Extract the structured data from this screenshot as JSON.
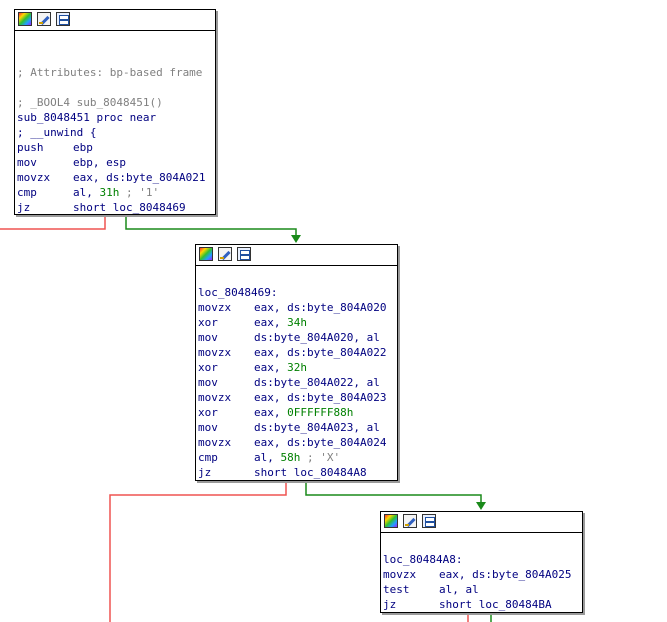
{
  "colors": {
    "edge_false": "#ef5350",
    "edge_true": "#1a8a1a",
    "text": "#000080",
    "comment": "#808080",
    "number": "#008000"
  },
  "header_icons": [
    "color-palette-icon",
    "edit-node-icon",
    "graph-overview-icon"
  ],
  "nodes": [
    {
      "lines": [
        {
          "kind": "blank"
        },
        {
          "kind": "blank"
        },
        {
          "kind": "comment",
          "text": "; Attributes: bp-based frame"
        },
        {
          "kind": "blank"
        },
        {
          "kind": "comment",
          "text": "; _BOOL4 sub_8048451()"
        },
        {
          "kind": "label",
          "text": "sub_8048451 proc near"
        },
        {
          "kind": "label",
          "text": "; __unwind {"
        },
        {
          "kind": "ins",
          "mnem": "push",
          "ops": "ebp"
        },
        {
          "kind": "ins",
          "mnem": "mov",
          "ops": "ebp, esp"
        },
        {
          "kind": "ins",
          "mnem": "movzx",
          "ops": "eax, ds:byte_804A021"
        },
        {
          "kind": "ins",
          "mnem": "cmp",
          "ops": "al, ",
          "num": "31h",
          "tail": " ; '1'"
        },
        {
          "kind": "ins",
          "mnem": "jz",
          "ops": "short loc_8048469"
        }
      ]
    },
    {
      "lines": [
        {
          "kind": "blank"
        },
        {
          "kind": "label",
          "text": "loc_8048469:"
        },
        {
          "kind": "ins",
          "mnem": "movzx",
          "ops": "eax, ds:byte_804A020"
        },
        {
          "kind": "ins",
          "mnem": "xor",
          "ops": "eax, ",
          "num": "34h"
        },
        {
          "kind": "ins",
          "mnem": "mov",
          "ops": "ds:byte_804A020, al"
        },
        {
          "kind": "ins",
          "mnem": "movzx",
          "ops": "eax, ds:byte_804A022"
        },
        {
          "kind": "ins",
          "mnem": "xor",
          "ops": "eax, ",
          "num": "32h"
        },
        {
          "kind": "ins",
          "mnem": "mov",
          "ops": "ds:byte_804A022, al"
        },
        {
          "kind": "ins",
          "mnem": "movzx",
          "ops": "eax, ds:byte_804A023"
        },
        {
          "kind": "ins",
          "mnem": "xor",
          "ops": "eax, ",
          "num": "0FFFFFF88h"
        },
        {
          "kind": "ins",
          "mnem": "mov",
          "ops": "ds:byte_804A023, al"
        },
        {
          "kind": "ins",
          "mnem": "movzx",
          "ops": "eax, ds:byte_804A024"
        },
        {
          "kind": "ins",
          "mnem": "cmp",
          "ops": "al, ",
          "num": "58h",
          "tail": " ; 'X'"
        },
        {
          "kind": "ins",
          "mnem": "jz",
          "ops": "short loc_80484A8"
        }
      ]
    },
    {
      "lines": [
        {
          "kind": "blank"
        },
        {
          "kind": "label",
          "text": "loc_80484A8:"
        },
        {
          "kind": "ins",
          "mnem": "movzx",
          "ops": "eax, ds:byte_804A025"
        },
        {
          "kind": "ins",
          "mnem": "test",
          "ops": "al, al"
        },
        {
          "kind": "ins",
          "mnem": "jz",
          "ops": "short loc_80484BA"
        }
      ]
    }
  ]
}
